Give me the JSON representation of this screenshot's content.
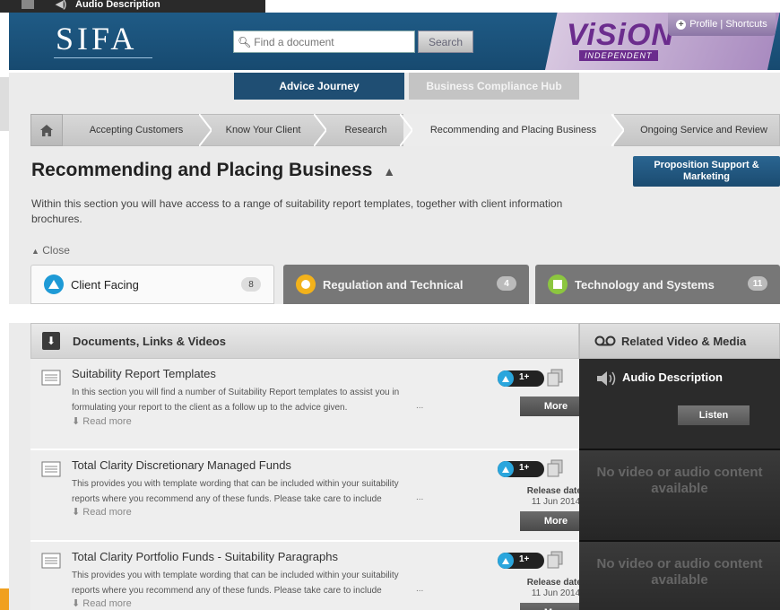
{
  "background_fragment": {
    "label": "Audio Description"
  },
  "header": {
    "logo": "SIFA",
    "search_placeholder": "Find a document",
    "search_button": "Search",
    "partner_logo": "ViSiON",
    "partner_sub": "INDEPENDENT",
    "profile_link": "Profile | Shortcuts"
  },
  "top_nav": [
    {
      "label": "Advice Journey",
      "active": true
    },
    {
      "label": "Business Compliance Hub",
      "active": false
    }
  ],
  "breadcrumb": [
    {
      "label": "Accepting Customers"
    },
    {
      "label": "Know Your Client"
    },
    {
      "label": "Research"
    },
    {
      "label": "Recommending and Placing Business",
      "active": true
    },
    {
      "label": "Ongoing Service and Review"
    }
  ],
  "page": {
    "title": "Recommending and Placing Business",
    "caret": "^",
    "proposition_button": "Proposition Support & Marketing",
    "intro": "Within this section you will have access to a range of suitability report templates, together with client information brochures.",
    "close_label": "Close"
  },
  "categories": [
    {
      "label": "Client Facing",
      "count": "8",
      "color": "#1e9ad6"
    },
    {
      "label": "Regulation and Technical",
      "count": "4",
      "color": "#f2b21b"
    },
    {
      "label": "Technology and Systems",
      "count": "11",
      "color": "#8cc63f"
    }
  ],
  "docs_panel": {
    "title": "Documents, Links & Videos",
    "media_title": "Related Video & Media",
    "read_more": "Read more",
    "more_button": "More",
    "release_label": "Release date:",
    "items": [
      {
        "title": "Suitability Report Templates",
        "desc_line1": " In this section you will find a number of Suitability Report templates to assist you in",
        "desc_line2": "formulating your report to the client as a follow up to the advice given.",
        "badge": "1+",
        "release_date": ""
      },
      {
        "title": "Total Clarity Discretionary Managed Funds",
        "desc_line1": "This provides you with template wording that can be included within your suitability",
        "desc_line2": "reports where you recommend any of these funds. Please take care to include",
        "badge": "1+",
        "release_date": "11 Jun 2014"
      },
      {
        "title": "Total Clarity Portfolio Funds - Suitability Paragraphs",
        "desc_line1": "This provides you with template wording that can be included within your suitability",
        "desc_line2": "reports where you recommend any of these funds. Please take care to include",
        "badge": "1+",
        "release_date": "11 Jun 2014"
      }
    ]
  },
  "media": [
    {
      "type": "audio",
      "title": "Audio Description",
      "button": "Listen"
    },
    {
      "type": "none",
      "text": "No video or audio content available"
    },
    {
      "type": "none",
      "text": "No video or audio content available"
    }
  ]
}
